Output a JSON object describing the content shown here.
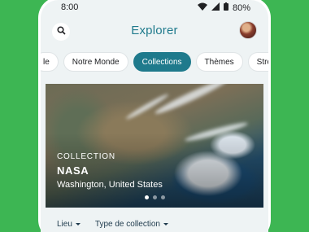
{
  "status": {
    "time": "8:00",
    "battery": "80%"
  },
  "header": {
    "title": "Explorer"
  },
  "chips": [
    {
      "label": "le",
      "active": false
    },
    {
      "label": "Notre Monde",
      "active": false
    },
    {
      "label": "Collections",
      "active": true
    },
    {
      "label": "Thèmes",
      "active": false
    },
    {
      "label": "Street V",
      "active": false
    }
  ],
  "hero": {
    "eyebrow": "COLLECTION",
    "title": "NASA",
    "subtitle": "Washington, United States",
    "page_count": 3,
    "active_page": 1
  },
  "filters": [
    {
      "label": "Lieu"
    },
    {
      "label": "Type de collection"
    }
  ],
  "colors": {
    "background": "#3db653",
    "accent": "#1f7a8c"
  }
}
